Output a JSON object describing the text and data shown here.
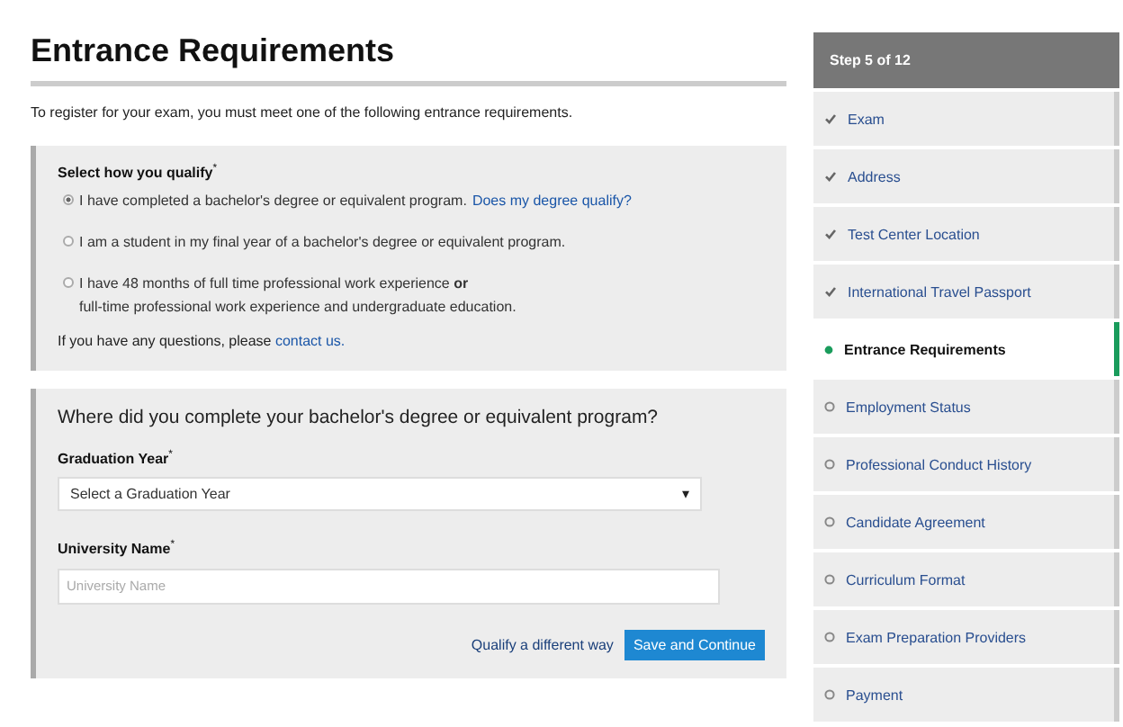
{
  "page": {
    "title": "Entrance Requirements",
    "intro": "To register for your exam, you must meet one of the following entrance requirements."
  },
  "qualify": {
    "label": "Select how you qualify",
    "required_mark": "*",
    "options": [
      {
        "text": "I have completed a bachelor's degree or equivalent program.",
        "link": "Does my degree qualify?",
        "selected": true
      },
      {
        "text": "I am a student in my final year of a bachelor's degree or equivalent program.",
        "selected": false
      },
      {
        "text": "I have 48 months of full time professional work experience **or**",
        "text_2": "full-time professional work experience and undergraduate education.",
        "selected": false
      }
    ],
    "help_text": "If you have any questions, please",
    "help_link": "contact us."
  },
  "degree": {
    "heading": "Where did you complete your bachelor's degree or equivalent program?",
    "graduation_label": "Graduation Year",
    "graduation_required": "*",
    "graduation_value": "Select a Graduation Year",
    "caret": "▾",
    "university_label": "University Name",
    "university_required": "*",
    "university_placeholder": "University Name",
    "alt_link": "Qualify a different way",
    "submit": "Save and Continue"
  },
  "steps": {
    "header": "Step 5 of 12",
    "items": [
      {
        "label": "Exam",
        "kind": "done",
        "selected": false
      },
      {
        "label": "Address",
        "kind": "done",
        "selected": false
      },
      {
        "label": "Test Center Location",
        "kind": "done",
        "selected": false
      },
      {
        "label": "International Travel Passport",
        "kind": "done",
        "selected": false
      },
      {
        "label": "Entrance Requirements",
        "kind": "current",
        "selected": true
      },
      {
        "label": "Employment Status",
        "kind": "todo",
        "selected": false
      },
      {
        "label": "Professional Conduct History",
        "kind": "todo",
        "selected": false
      },
      {
        "label": "Candidate Agreement",
        "kind": "todo",
        "selected": false
      },
      {
        "label": "Curriculum Format",
        "kind": "todo",
        "selected": false
      },
      {
        "label": "Exam Preparation Providers",
        "kind": "todo",
        "selected": false
      },
      {
        "label": "Payment",
        "kind": "todo",
        "selected": false
      }
    ]
  }
}
